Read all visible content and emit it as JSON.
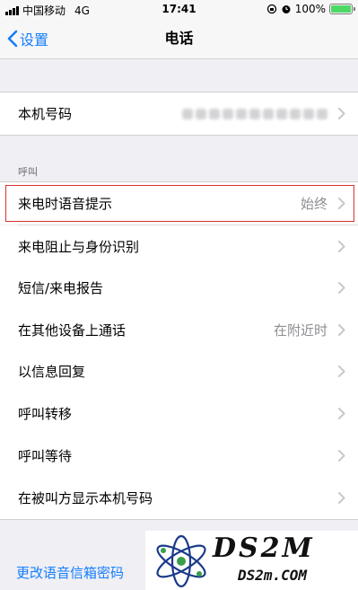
{
  "status_bar": {
    "carrier": "中国移动",
    "network": "4G",
    "time": "17:41",
    "battery": "100%",
    "icons": [
      "signal-icon",
      "orientation-lock-icon",
      "alarm-icon",
      "battery-icon"
    ]
  },
  "nav": {
    "back_label": "设置",
    "title": "电话"
  },
  "my_number": {
    "label": "本机号码",
    "value_obscured": true
  },
  "call_section": {
    "header": "呼叫",
    "items": [
      {
        "label": "来电时语音提示",
        "detail": "始终",
        "highlighted": true
      },
      {
        "label": "来电阻止与身份识别",
        "detail": ""
      },
      {
        "label": "短信/来电报告",
        "detail": ""
      },
      {
        "label": "在其他设备上通话",
        "detail": "在附近时"
      },
      {
        "label": "以信息回复",
        "detail": ""
      },
      {
        "label": "呼叫转移",
        "detail": ""
      },
      {
        "label": "呼叫等待",
        "detail": ""
      },
      {
        "label": "在被叫方显示本机号码",
        "detail": ""
      }
    ]
  },
  "voicemail": {
    "label": "更改语音信箱密码"
  },
  "watermark": {
    "brand": "DS2M",
    "domain": "DS2m.COM"
  },
  "colors": {
    "accent": "#157efb",
    "highlight_border": "#d9352d",
    "background": "#efeff4",
    "battery_fill": "#4cd964"
  }
}
